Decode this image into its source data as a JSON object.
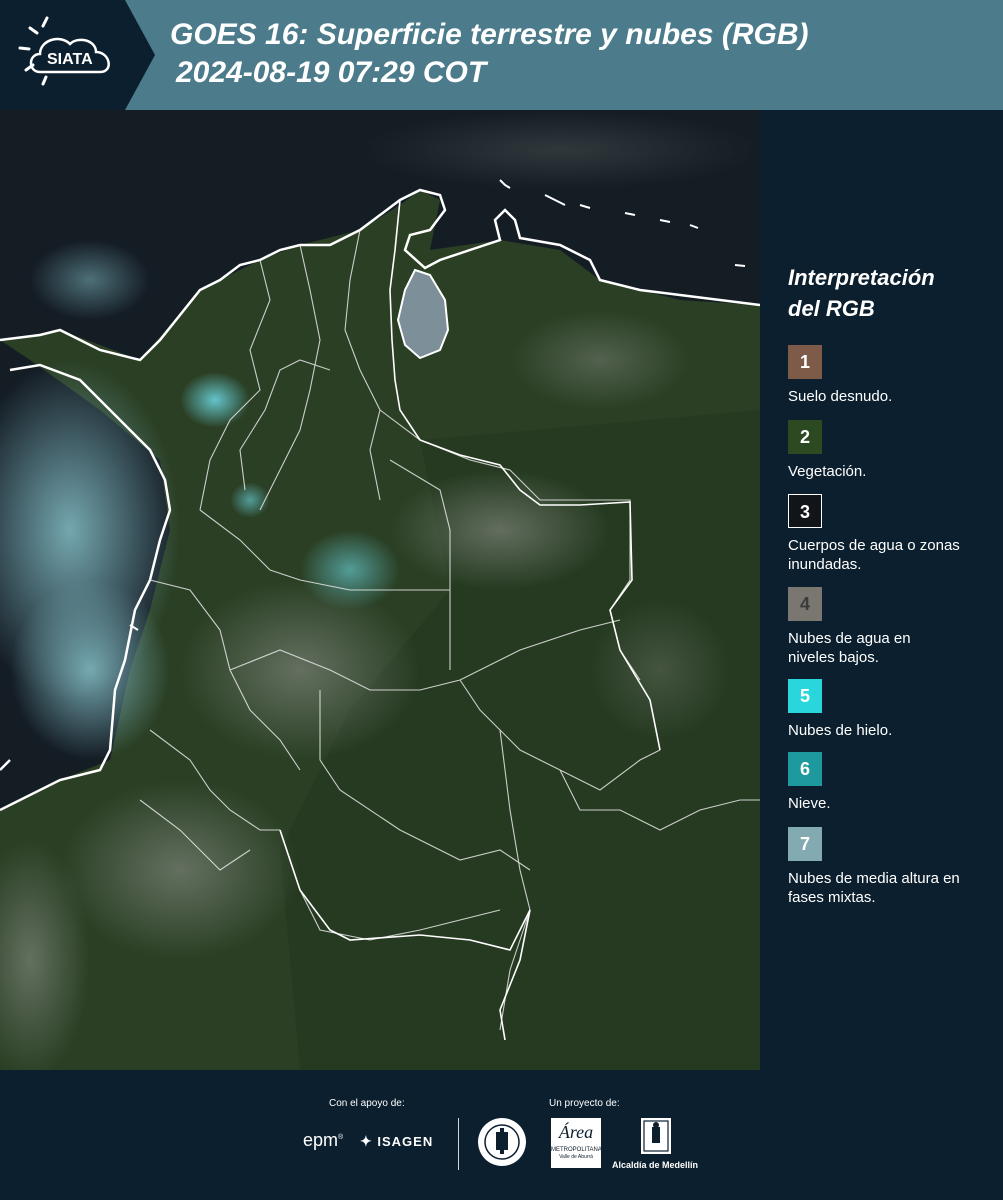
{
  "header": {
    "logo_text": "SIATA",
    "title_line1": "GOES 16: Superficie terrestre y nubes (RGB)",
    "title_line2": "2024-08-19 07:29 COT"
  },
  "legend": {
    "title_line1": "Interpretación",
    "title_line2": "del RGB",
    "items": [
      {
        "number": "1",
        "label": "Suelo desnudo.",
        "color": "#7e5a48"
      },
      {
        "number": "2",
        "label": "Vegetación.",
        "color": "#2c4a22"
      },
      {
        "number": "3",
        "label": "Cuerpos de agua o zonas inundadas.",
        "color": "#111418"
      },
      {
        "number": "4",
        "label": "Nubes de agua en niveles bajos.",
        "color": "#7a7670"
      },
      {
        "number": "5",
        "label": "Nubes de hielo.",
        "color": "#29d6dc"
      },
      {
        "number": "6",
        "label": "Nieve.",
        "color": "#1e9a9e"
      },
      {
        "number": "7",
        "label": "Nubes de media altura en fases mixtas.",
        "color": "#82aab0"
      }
    ]
  },
  "footer": {
    "support_label": "Con el apoyo de:",
    "project_label": "Un proyecto de:",
    "brand_epm": "epm",
    "brand_isagen": "ISAGEN",
    "brand_area": "Área",
    "brand_area_sub1": "METROPOLITANA",
    "brand_area_sub2": "Valle de Aburrá",
    "brand_alcaldia": "Alcaldía de Medellín"
  }
}
